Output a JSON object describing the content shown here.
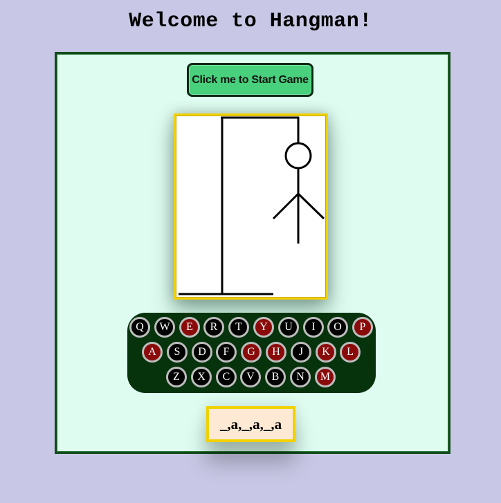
{
  "page": {
    "title": "Welcome to Hangman!"
  },
  "game": {
    "start_button_label": "Click me to Start Game",
    "word_display": "_,a,_,a,_,a",
    "hangman_parts_drawn": [
      "gallows",
      "head",
      "body",
      "left-arm",
      "right-arm"
    ]
  },
  "keyboard": {
    "rows": [
      [
        {
          "letter": "Q",
          "state": "unused"
        },
        {
          "letter": "W",
          "state": "unused"
        },
        {
          "letter": "E",
          "state": "used"
        },
        {
          "letter": "R",
          "state": "unused"
        },
        {
          "letter": "T",
          "state": "unused"
        },
        {
          "letter": "Y",
          "state": "used"
        },
        {
          "letter": "U",
          "state": "unused"
        },
        {
          "letter": "I",
          "state": "unused"
        },
        {
          "letter": "O",
          "state": "unused"
        },
        {
          "letter": "P",
          "state": "used"
        }
      ],
      [
        {
          "letter": "A",
          "state": "used"
        },
        {
          "letter": "S",
          "state": "unused"
        },
        {
          "letter": "D",
          "state": "unused"
        },
        {
          "letter": "F",
          "state": "unused"
        },
        {
          "letter": "G",
          "state": "used"
        },
        {
          "letter": "H",
          "state": "used"
        },
        {
          "letter": "J",
          "state": "unused"
        },
        {
          "letter": "K",
          "state": "used"
        },
        {
          "letter": "L",
          "state": "used"
        }
      ],
      [
        {
          "letter": "Z",
          "state": "unused"
        },
        {
          "letter": "X",
          "state": "unused"
        },
        {
          "letter": "C",
          "state": "unused"
        },
        {
          "letter": "V",
          "state": "unused"
        },
        {
          "letter": "B",
          "state": "unused"
        },
        {
          "letter": "N",
          "state": "unused"
        },
        {
          "letter": "M",
          "state": "used"
        }
      ]
    ]
  },
  "colors": {
    "background": "#c8c8e6",
    "panel": "#defcf0",
    "panel_border": "#124b1a",
    "start_button": "#48d07c",
    "frame_gold": "#f1d100",
    "keyboard_bg": "#06330c",
    "key_unused": "#000000",
    "key_used": "#8a0a0a",
    "word_box": "#fde9d4"
  }
}
